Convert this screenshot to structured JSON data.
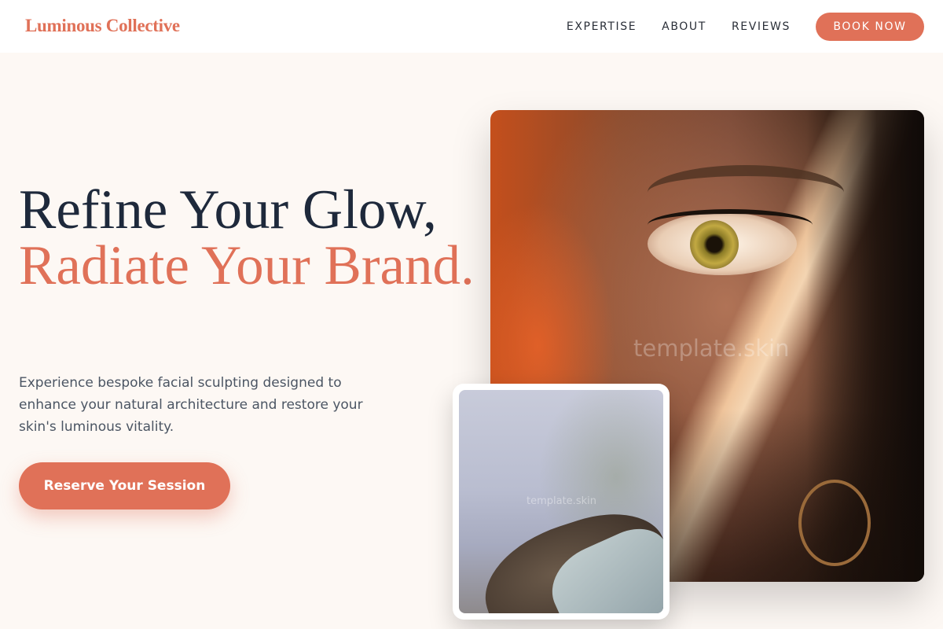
{
  "header": {
    "logo": "Luminous Collective",
    "nav": [
      {
        "label": "EXPERTISE"
      },
      {
        "label": "ABOUT"
      },
      {
        "label": "REVIEWS"
      }
    ],
    "book_label": "BOOK NOW"
  },
  "hero": {
    "title_line1": "Refine Your Glow,",
    "title_accent": "Radiate Your Brand.",
    "description": "Experience bespoke facial sculpting designed to enhance your natural architecture and restore your skin's luminous vitality.",
    "cta_label": "Reserve Your Session"
  },
  "images": {
    "main_watermark": "template.skin",
    "inset_watermark": "template.skin"
  },
  "colors": {
    "accent": "#e07158",
    "heading": "#1e293b",
    "background": "#fdf8f4"
  }
}
